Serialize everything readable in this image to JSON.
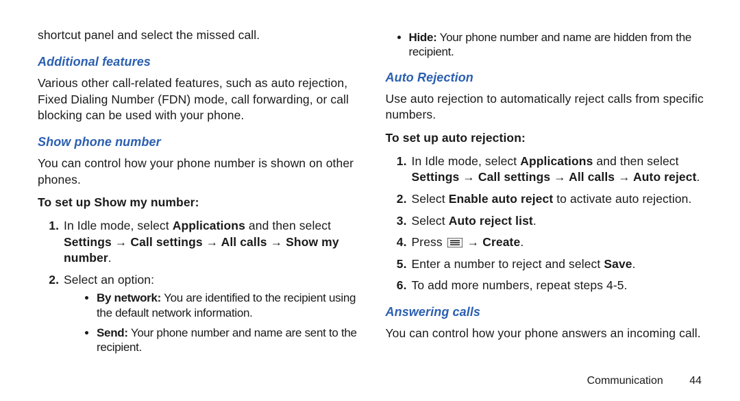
{
  "left": {
    "top_line": "shortcut panel and select the missed call.",
    "h1": "Additional features",
    "p1": "Various other call-related features, such as auto rejection, Fixed Dialing Number (FDN) mode, call forwarding, or call blocking can be used with your phone.",
    "h2": "Show phone number",
    "p2": "You can control how your phone number is shown on other phones.",
    "sub1": "To set up Show my number:",
    "step1_a": "In Idle mode, select ",
    "step1_b": "Applications",
    "step1_c": " and then select ",
    "step1_path": "Settings → Call settings → All calls → Show my number",
    "step1_end": ".",
    "step2": "Select an option:",
    "bullet1_a": "By network:",
    "bullet1_b": " You are identified to the recipient using the default network information.",
    "bullet2_a": "Send:",
    "bullet2_b": " Your phone number and name are sent to the recipient."
  },
  "right": {
    "bullet3_a": "Hide:",
    "bullet3_b": " Your phone number and name are hidden from the recipient.",
    "h1": "Auto Rejection",
    "p1": "Use auto rejection to automatically reject calls from specific numbers.",
    "sub1": "To set up auto rejection:",
    "r1_a": "In Idle mode, select ",
    "r1_b": "Applications",
    "r1_c": " and then select ",
    "r1_path": "Settings → Call settings → All calls → Auto reject",
    "r1_end": ".",
    "r2_a": "Select ",
    "r2_b": "Enable auto reject",
    "r2_c": " to activate auto rejection.",
    "r3_a": "Select ",
    "r3_b": "Auto reject list",
    "r3_end": ".",
    "r4_a": "Press  ",
    "r4_b": " → ",
    "r4_c": "Create",
    "r4_end": ".",
    "r5_a": "Enter a number to reject and select ",
    "r5_b": "Save",
    "r5_end": ".",
    "r6": "To add more numbers, repeat steps 4-5.",
    "h2": "Answering calls",
    "p2": "You can control how your phone answers an incoming call."
  },
  "footer": {
    "section": "Communication",
    "page": "44"
  }
}
